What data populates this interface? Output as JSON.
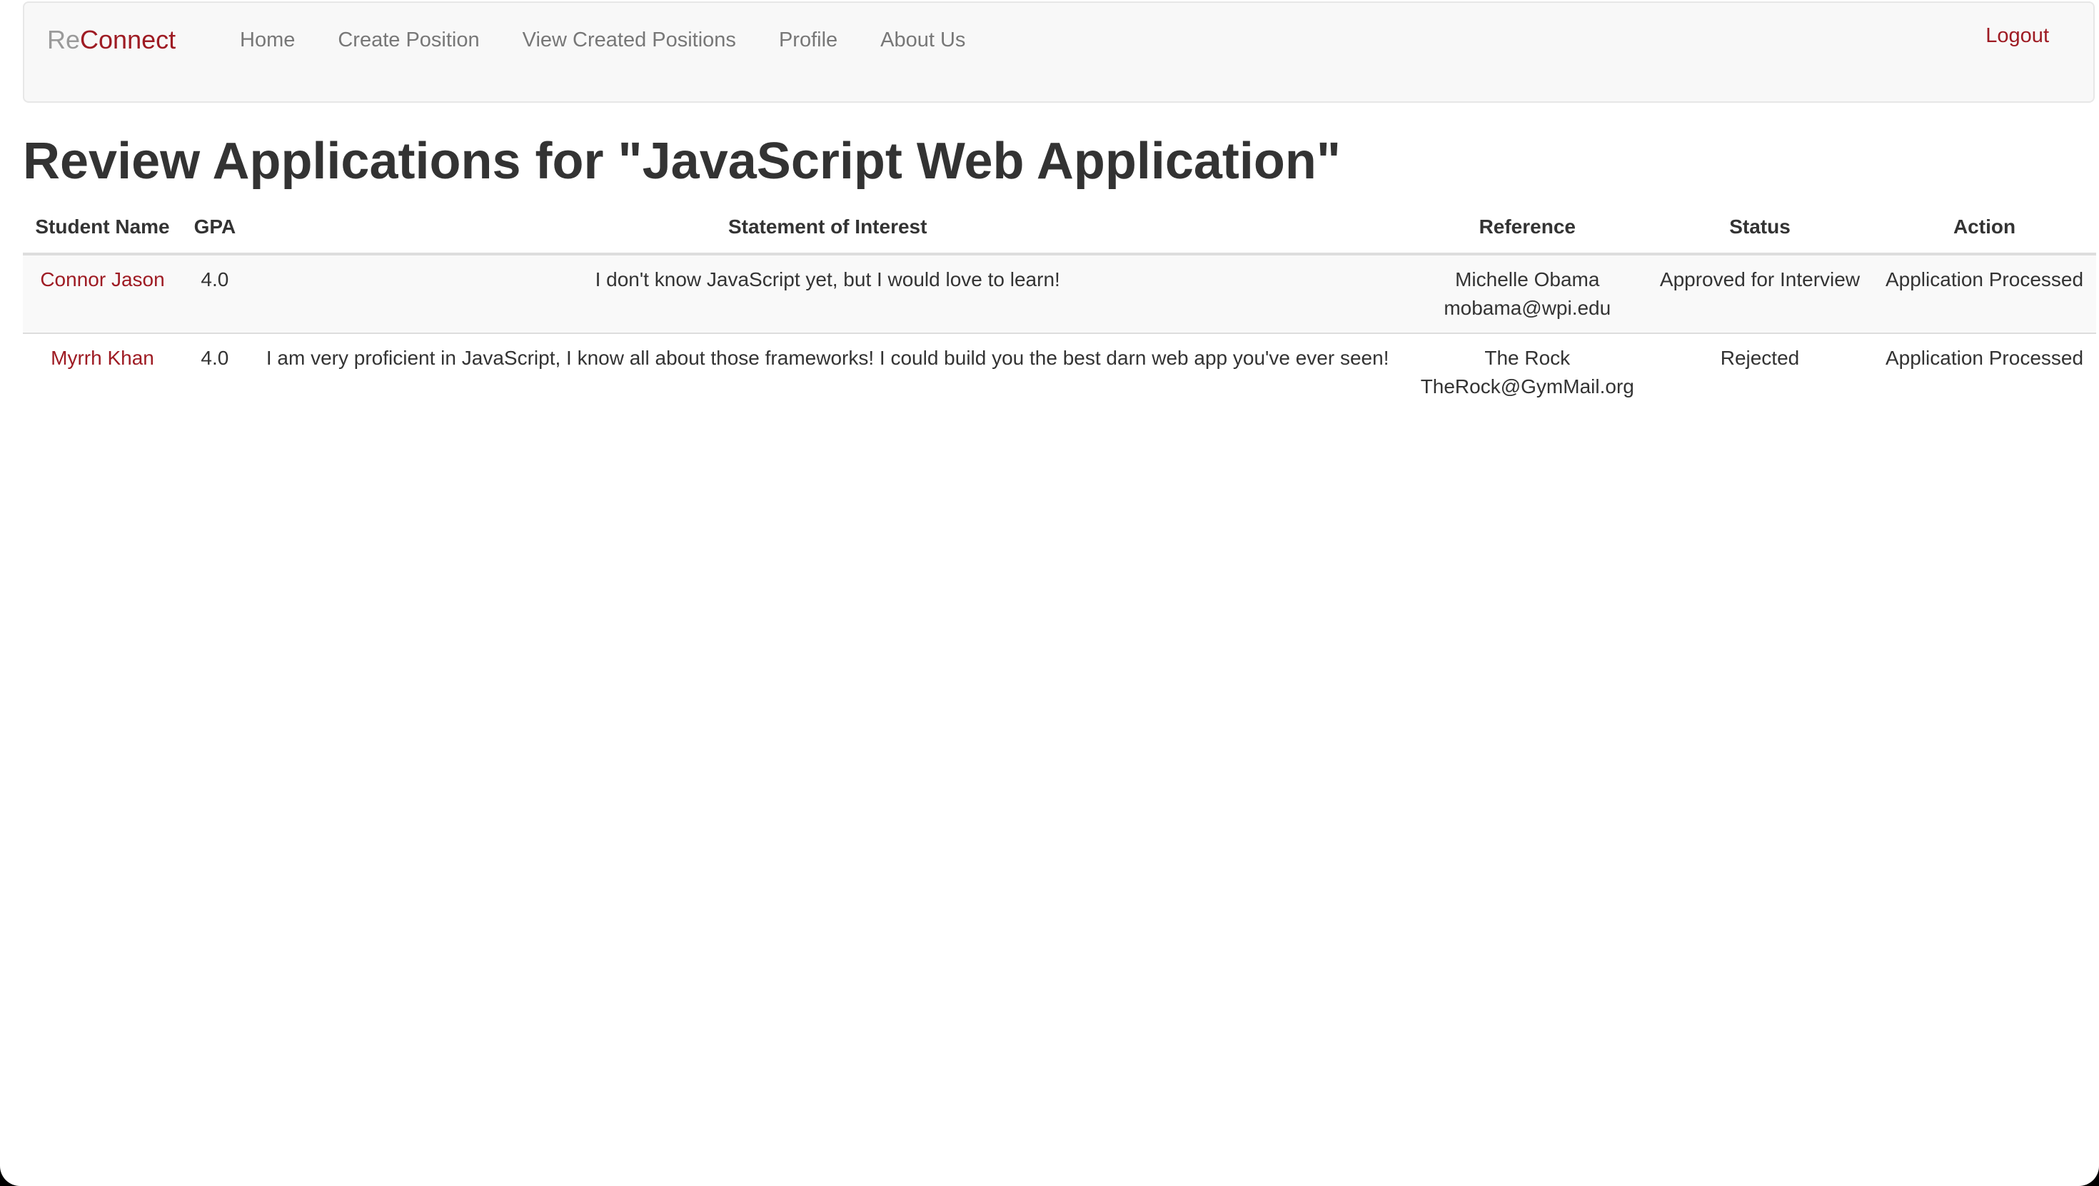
{
  "navbar": {
    "brand_prefix": "Re",
    "brand_suffix": "Connect",
    "links": [
      {
        "label": "Home"
      },
      {
        "label": "Create Position"
      },
      {
        "label": "View Created Positions"
      },
      {
        "label": "Profile"
      },
      {
        "label": "About Us"
      }
    ],
    "logout_label": "Logout"
  },
  "page": {
    "title": "Review Applications for \"JavaScript Web Application\""
  },
  "table": {
    "headers": {
      "student_name": "Student Name",
      "gpa": "GPA",
      "statement": "Statement of Interest",
      "reference": "Reference",
      "status": "Status",
      "action": "Action"
    },
    "rows": [
      {
        "student_name": "Connor Jason",
        "gpa": "4.0",
        "statement": "I don't know JavaScript yet, but I would love to learn!",
        "reference_name": "Michelle Obama",
        "reference_email": "mobama@wpi.edu",
        "status": "Approved for Interview",
        "action": "Application Processed"
      },
      {
        "student_name": "Myrrh Khan",
        "gpa": "4.0",
        "statement": "I am very proficient in JavaScript, I know all about those frameworks! I could build you the best darn web app you've ever seen!",
        "reference_name": "The Rock",
        "reference_email": "TheRock@GymMail.org",
        "status": "Rejected",
        "action": "Application Processed"
      }
    ]
  },
  "colors": {
    "brand_accent": "#9e1b23",
    "brand_muted": "#9a9a9a",
    "navbar_bg": "#f8f8f8",
    "text": "#333333"
  }
}
